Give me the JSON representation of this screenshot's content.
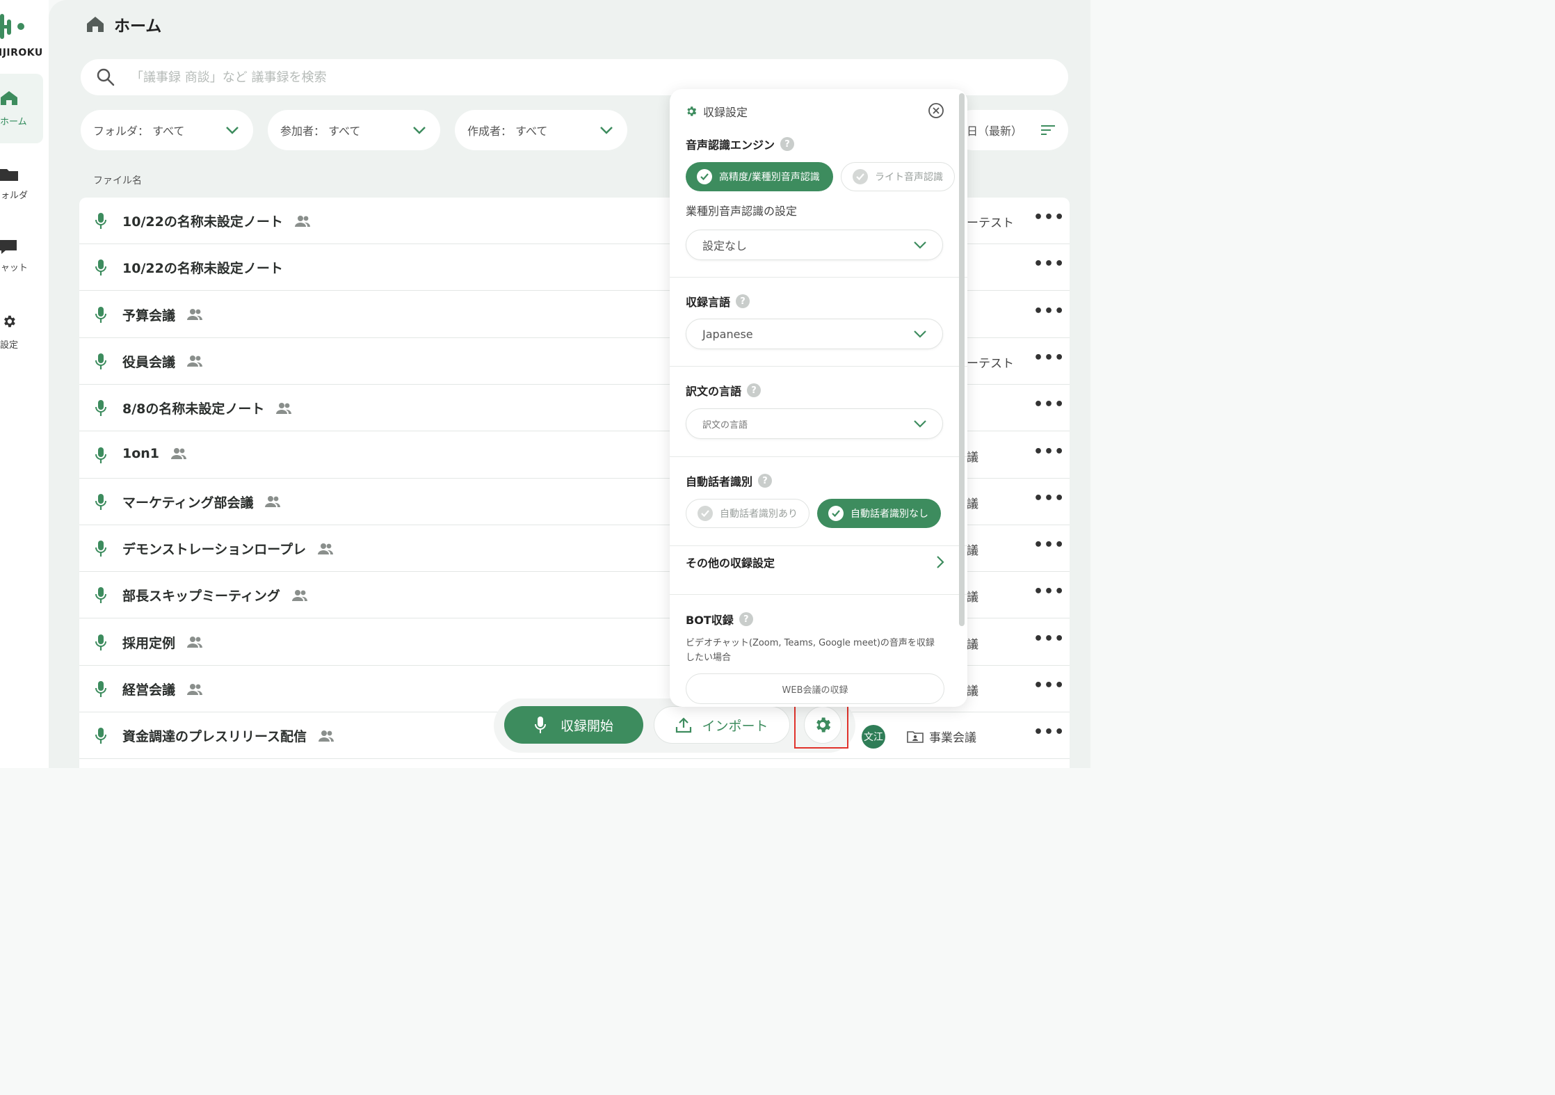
{
  "app": {
    "logo_text": "IJIROKU",
    "brand_color": "#3d8c5e"
  },
  "sidebar": {
    "items": [
      {
        "label": "ホーム",
        "icon": "home-icon",
        "active": true
      },
      {
        "label": "フォルダ",
        "icon": "folder-icon",
        "active": false
      },
      {
        "label": "チャット",
        "icon": "chat-icon",
        "active": false
      },
      {
        "label": "設定",
        "icon": "gear-icon",
        "active": false
      }
    ]
  },
  "header": {
    "title": "ホーム"
  },
  "search": {
    "placeholder": "「議事録 商談」など 議事録を検索"
  },
  "filters": [
    {
      "label": "フォルダ：",
      "value": "すべて"
    },
    {
      "label": "参加者：",
      "value": "すべて"
    },
    {
      "label": "作成者：",
      "value": "すべて"
    }
  ],
  "sort": {
    "label": "日（最新）"
  },
  "table": {
    "column_header": "ファイル名",
    "rows": [
      {
        "title": "10/22の名称未設定ノート",
        "shared": true,
        "meta": "ーテスト"
      },
      {
        "title": "10/22の名称未設定ノート",
        "shared": false,
        "meta": ""
      },
      {
        "title": "予算会議",
        "shared": true,
        "meta": ""
      },
      {
        "title": "役員会議",
        "shared": true,
        "meta": "ーテスト"
      },
      {
        "title": "8/8の名称未設定ノート",
        "shared": true,
        "meta": ""
      },
      {
        "title": "1on1",
        "shared": true,
        "meta": "議"
      },
      {
        "title": "マーケティング部会議",
        "shared": true,
        "meta": "議"
      },
      {
        "title": "デモンストレーションロープレ",
        "shared": true,
        "meta": "議"
      },
      {
        "title": "部長スキップミーティング",
        "shared": true,
        "meta": "議"
      },
      {
        "title": "採用定例",
        "shared": true,
        "meta": "議"
      },
      {
        "title": "経営会議",
        "shared": true,
        "meta": "議"
      },
      {
        "title": "資金調達のプレスリリース配信",
        "shared": true,
        "meta": ""
      }
    ],
    "more_label": "•••"
  },
  "last_row": {
    "avatar": "文江",
    "folder": "事業会議"
  },
  "actions": {
    "record": "収録開始",
    "import": "インポート"
  },
  "settings_panel": {
    "title": "収録設定",
    "engine": {
      "title": "音声認識エンジン",
      "options": [
        {
          "label": "高精度/業種別音声認識",
          "selected": true
        },
        {
          "label": "ライト音声認識",
          "selected": false
        }
      ],
      "industry_label": "業種別音声認識の設定",
      "industry_value": "設定なし"
    },
    "language": {
      "title": "収録言語",
      "value": "Japanese"
    },
    "translation": {
      "title": "訳文の言語",
      "placeholder": "訳文の言語"
    },
    "speaker": {
      "title": "自動話者識別",
      "options": [
        {
          "label": "自動話者識別あり",
          "selected": false
        },
        {
          "label": "自動話者識別なし",
          "selected": true
        }
      ]
    },
    "other": {
      "label": "その他の収録設定"
    },
    "bot": {
      "title": "BOT収録",
      "description": "ビデオチャット(Zoom, Teams, Google meet)の音声を収録したい場合",
      "button": "WEB会議の収録"
    },
    "help_mark": "?"
  }
}
